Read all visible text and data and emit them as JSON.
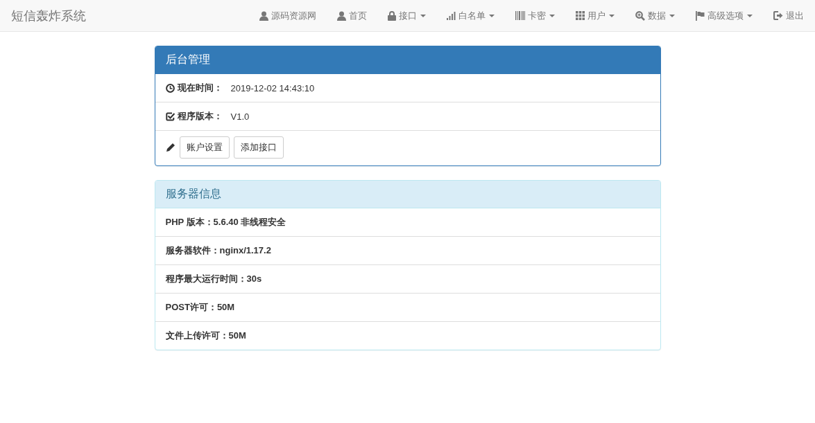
{
  "navbar": {
    "brand": "短信轰炸系统",
    "items": [
      {
        "label": "源码资源网",
        "dropdown": false
      },
      {
        "label": "首页",
        "dropdown": false
      },
      {
        "label": "接口",
        "dropdown": true
      },
      {
        "label": "白名单",
        "dropdown": true
      },
      {
        "label": "卡密",
        "dropdown": true
      },
      {
        "label": "用户",
        "dropdown": true
      },
      {
        "label": "数据",
        "dropdown": true
      },
      {
        "label": "高级选项",
        "dropdown": true
      },
      {
        "label": "退出",
        "dropdown": false
      }
    ]
  },
  "admin_panel": {
    "title": "后台管理",
    "rows": [
      {
        "label": "现在时间：",
        "value": "2019-12-02 14:43:10"
      },
      {
        "label": "程序版本：",
        "value": "V1.0"
      }
    ],
    "buttons": [
      "账户设置",
      "添加接口"
    ]
  },
  "server_panel": {
    "title": "服务器信息",
    "rows": [
      "PHP 版本：5.6.40 非线程安全",
      "服务器软件：nginx/1.17.2",
      "程序最大运行时间：30s",
      "POST许可：50M",
      "文件上传许可：50M"
    ]
  }
}
